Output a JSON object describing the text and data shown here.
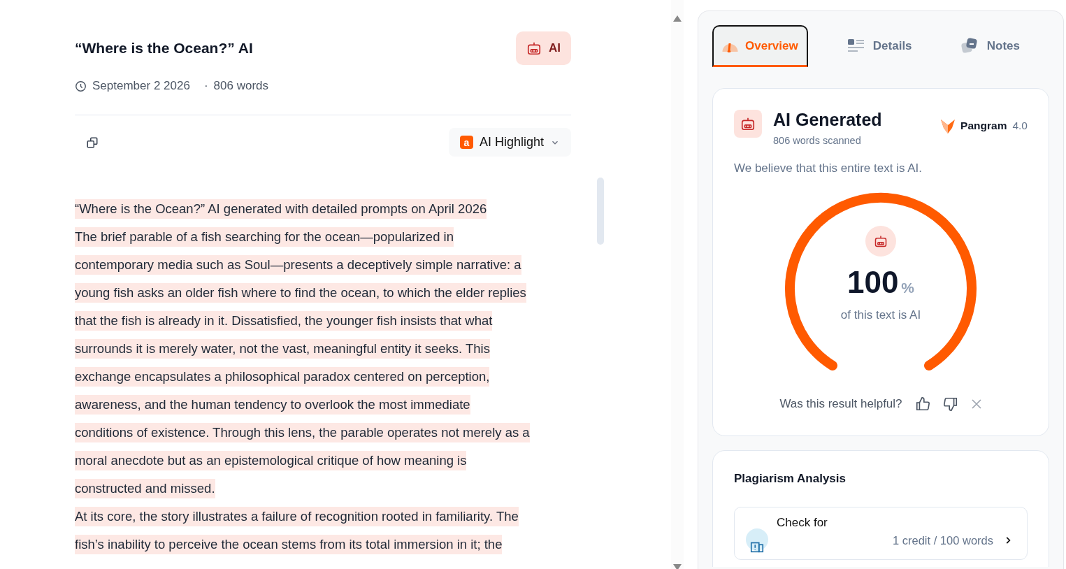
{
  "document": {
    "title": "“Where is the Ocean?” AI",
    "badge": "AI",
    "date": "September 2 2026",
    "separator": "·",
    "word_count": "806 words",
    "highlight_menu": {
      "letter": "a",
      "label": "AI Highlight"
    },
    "lines": [
      "“Where is the Ocean?” AI generated with detailed prompts on April 2026",
      "The brief parable of a fish searching for the ocean—popularized in",
      "contemporary media such as Soul—presents a deceptively simple narrative: a",
      "young fish asks an older fish where to find the ocean, to which the elder replies",
      "that the fish is already in it. Dissatisfied, the younger fish insists that what",
      "surrounds it is merely water, not the vast, meaningful entity it seeks. This",
      "exchange encapsulates a philosophical paradox centered on perception,",
      "awareness, and the human tendency to overlook the most immediate",
      "conditions of existence. Through this lens, the parable operates not merely as a",
      "moral anecdote but as an epistemological critique of how meaning is",
      "constructed and missed.",
      "At its core, the story illustrates a failure of recognition rooted in familiarity. The",
      "fish’s inability to perceive the ocean stems from its total immersion in it; the"
    ]
  },
  "panel": {
    "tabs": [
      {
        "label": "Overview",
        "kind": "overview",
        "selected": true
      },
      {
        "label": "Details",
        "kind": "details",
        "selected": false
      },
      {
        "label": "Notes",
        "kind": "notes",
        "selected": false
      }
    ],
    "result": {
      "title": "AI Generated",
      "subtitle": "806 words scanned",
      "model": "Pangram",
      "version": "4.0",
      "summary": "We believe that this entire text is AI.",
      "level": 1,
      "score": "100",
      "unit": "%",
      "caption": "of this text is AI",
      "feedback": "Was this result helpful?"
    },
    "plagiarism": {
      "title": "Plagiarism Analysis",
      "action": "Check for",
      "cost": "1 credit / 100 words"
    }
  }
}
